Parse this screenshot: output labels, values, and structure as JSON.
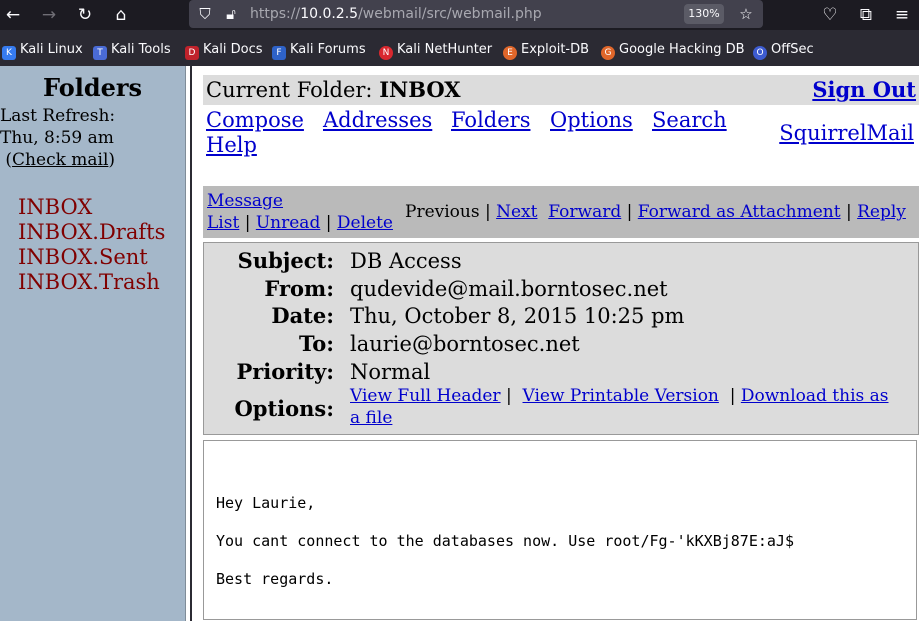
{
  "browser": {
    "url_prefix": "https://",
    "url_host": "10.0.2.5",
    "url_path": "/webmail/src/webmail.php",
    "zoom": "130%",
    "bookmarks": [
      {
        "label": "Kali Linux",
        "icon": "kali-dragon-icon"
      },
      {
        "label": "Kali Tools",
        "icon": "kali-tools-icon"
      },
      {
        "label": "Kali Docs",
        "icon": "kali-docs-icon"
      },
      {
        "label": "Kali Forums",
        "icon": "kali-forums-icon"
      },
      {
        "label": "Kali NetHunter",
        "icon": "nethunter-icon"
      },
      {
        "label": "Exploit-DB",
        "icon": "exploit-db-icon"
      },
      {
        "label": "Google Hacking DB",
        "icon": "ghdb-icon"
      },
      {
        "label": "OffSec",
        "icon": "offsec-icon"
      }
    ]
  },
  "left": {
    "title": "Folders",
    "last_refresh_label": "Last Refresh:",
    "last_refresh_time": "Thu, 8:59 am",
    "check_mail": "Check mail",
    "folders": [
      "INBOX",
      "INBOX.Drafts",
      "INBOX.Sent",
      "INBOX.Trash"
    ]
  },
  "top": {
    "current_folder_label": "Current Folder:",
    "current_folder": "INBOX",
    "sign_out": "Sign Out",
    "menu": [
      "Compose",
      "Addresses",
      "Folders",
      "Options",
      "Search",
      "Help"
    ],
    "brand": "SquirrelMail"
  },
  "message_nav": {
    "message_list_1": "Message",
    "message_list_2": "List",
    "unread": "Unread",
    "delete": "Delete",
    "previous": "Previous",
    "next": "Next",
    "forward": "Forward",
    "forward_attachment": "Forward as Attachment",
    "reply": "Reply"
  },
  "headers": {
    "subject_label": "Subject:",
    "subject": "DB Access",
    "from_label": "From:",
    "from": "qudevide@mail.borntosec.net",
    "date_label": "Date:",
    "date": "Thu, October 8, 2015 10:25 pm",
    "to_label": "To:",
    "to": "laurie@borntosec.net",
    "priority_label": "Priority:",
    "priority": "Normal",
    "options_label": "Options:",
    "view_full_header": "View Full Header",
    "view_printable": "View Printable Version",
    "download_1": "Download this as",
    "download_2": "a file"
  },
  "body": {
    "greeting": "Hey Laurie,",
    "line": "You cant connect to the databases now. Use root/Fg-'kKXBj87E:aJ$",
    "closing": "Best regards."
  },
  "colors": {
    "left_pane": "#a4b7c9",
    "link": "#0000cc",
    "folder_link": "#800000",
    "header_bg": "#dcdcdc"
  }
}
